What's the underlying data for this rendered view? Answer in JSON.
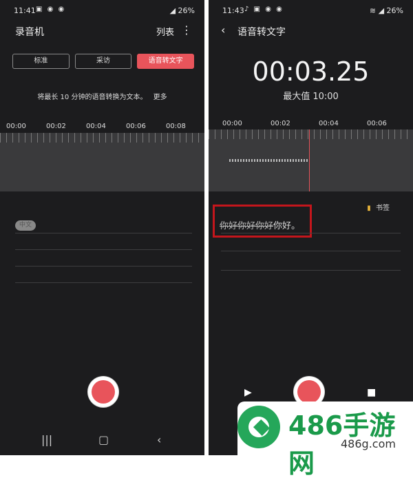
{
  "left": {
    "status": {
      "time": "11:41",
      "battery": "26%"
    },
    "title": "录音机",
    "list_label": "列表",
    "modes": [
      "标准",
      "采访",
      "语音转文字"
    ],
    "description": "将最长 10 分钟的语音转换为文本。",
    "more_link": "更多",
    "ticks": [
      "00:00",
      "00:02",
      "00:04",
      "00:06",
      "00:08"
    ],
    "language_chip": "中文"
  },
  "right": {
    "status": {
      "time": "11:43",
      "battery": "26%"
    },
    "title": "语音转文字",
    "timer": "00:03.25",
    "max_value": "最大值 10:00",
    "ticks": [
      "00:00",
      "00:02",
      "00:04",
      "00:06"
    ],
    "bookmark_label": "书签",
    "transcript_struck": "你好你好你好",
    "transcript_plain": "你好。"
  },
  "watermark": {
    "title": "486手游网",
    "url": "486g.com"
  }
}
